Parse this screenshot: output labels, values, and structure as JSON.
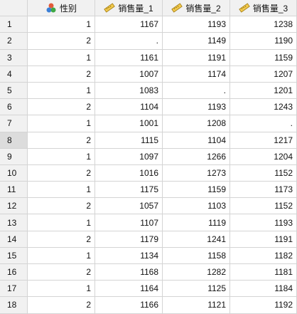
{
  "columns": [
    {
      "label": "性别",
      "icon": "nominal-variable-icon"
    },
    {
      "label": "销售量_1",
      "icon": "scale-variable-icon"
    },
    {
      "label": "销售量_2",
      "icon": "scale-variable-icon"
    },
    {
      "label": "销售量_3",
      "icon": "scale-variable-icon"
    }
  ],
  "rows": [
    {
      "n": "1",
      "v": [
        "1",
        "1167",
        "1193",
        "1238"
      ]
    },
    {
      "n": "2",
      "v": [
        "2",
        ".",
        "1149",
        "1190"
      ]
    },
    {
      "n": "3",
      "v": [
        "1",
        "1161",
        "1191",
        "1159"
      ]
    },
    {
      "n": "4",
      "v": [
        "2",
        "1007",
        "1174",
        "1207"
      ]
    },
    {
      "n": "5",
      "v": [
        "1",
        "1083",
        ".",
        "1201"
      ]
    },
    {
      "n": "6",
      "v": [
        "2",
        "1104",
        "1193",
        "1243"
      ]
    },
    {
      "n": "7",
      "v": [
        "1",
        "1001",
        "1208",
        "."
      ]
    },
    {
      "n": "8",
      "v": [
        "2",
        "1115",
        "1104",
        "1217"
      ]
    },
    {
      "n": "9",
      "v": [
        "1",
        "1097",
        "1266",
        "1204"
      ]
    },
    {
      "n": "10",
      "v": [
        "2",
        "1016",
        "1273",
        "1152"
      ]
    },
    {
      "n": "11",
      "v": [
        "1",
        "1175",
        "1159",
        "1173"
      ]
    },
    {
      "n": "12",
      "v": [
        "2",
        "1057",
        "1103",
        "1152"
      ]
    },
    {
      "n": "13",
      "v": [
        "1",
        "1107",
        "1119",
        "1193"
      ]
    },
    {
      "n": "14",
      "v": [
        "2",
        "1179",
        "1241",
        "1191"
      ]
    },
    {
      "n": "15",
      "v": [
        "1",
        "1134",
        "1158",
        "1182"
      ]
    },
    {
      "n": "16",
      "v": [
        "2",
        "1168",
        "1282",
        "1181"
      ]
    },
    {
      "n": "17",
      "v": [
        "1",
        "1164",
        "1125",
        "1184"
      ]
    },
    {
      "n": "18",
      "v": [
        "2",
        "1166",
        "1121",
        "1192"
      ]
    }
  ],
  "selected_row": "8",
  "colors": {
    "header_bg": "#f1f1f1",
    "gridline": "#d4d4d4",
    "selected_rownum_bg": "#dcdcdc"
  }
}
